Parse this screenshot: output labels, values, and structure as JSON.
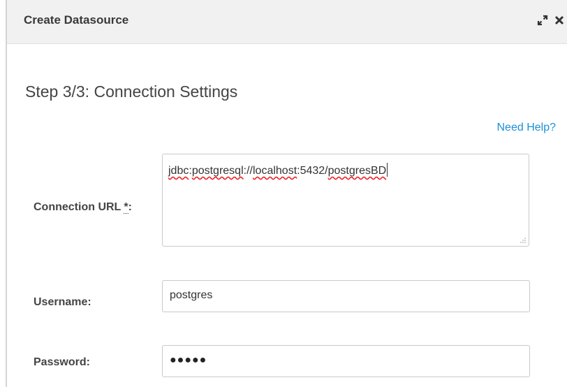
{
  "dialog": {
    "title": "Create Datasource",
    "icons": [
      "expand-icon",
      "close-icon"
    ]
  },
  "step": {
    "heading": "Step 3/3: Connection Settings"
  },
  "help": {
    "label": "Need Help?"
  },
  "form": {
    "connection_url": {
      "label": "Connection URL",
      "required_marker": "*",
      "label_suffix": ":",
      "value_parts": [
        "jdbc",
        ":",
        "postgresql",
        "://",
        "localhost",
        ":5432/",
        "postgresBD"
      ]
    },
    "username": {
      "label": "Username:",
      "value": "postgres"
    },
    "password": {
      "label": "Password:",
      "masked_value": "●●●●●"
    }
  },
  "colors": {
    "link": "#1a8fd6",
    "titlebar_bg": "#f1f1f1",
    "border": "#c9c9c9"
  }
}
